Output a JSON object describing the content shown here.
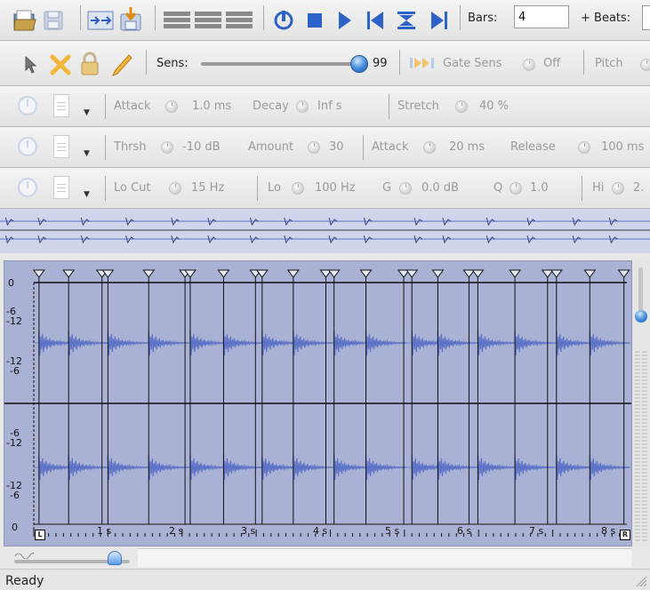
{
  "toolbar": {
    "bars_label": "Bars:",
    "bars_value": "4",
    "beats_label": "+ Beats:"
  },
  "toolbar2": {
    "sens_label": "Sens:",
    "sens_value": "99",
    "sens_level": 0.99,
    "gate_sens_label": "Gate Sens",
    "off_label": "Off",
    "pitch_label": "Pitch"
  },
  "envelope": {
    "attack_label": "Attack",
    "attack_value": "1.0 ms",
    "decay_label": "Decay",
    "decay_value": "Inf s",
    "stretch_label": "Stretch",
    "stretch_value": "40 %"
  },
  "compressor": {
    "thrsh_label": "Thrsh",
    "thrsh_value": "-10 dB",
    "amount_label": "Amount",
    "amount_value": "30",
    "attack_label": "Attack",
    "attack_value": "20 ms",
    "release_label": "Release",
    "release_value": "100 ms"
  },
  "eq": {
    "locut_label": "Lo Cut",
    "locut_value": "15 Hz",
    "lo_label": "Lo",
    "lo_value": "100 Hz",
    "g_label": "G",
    "g_value": "0.0 dB",
    "q_label": "Q",
    "q_value": "1.0",
    "hi_label": "Hi",
    "hi_value": "2."
  },
  "waveform": {
    "db_labels": [
      "0",
      "-6",
      "-12",
      "-12",
      "-6",
      "-6",
      "-12",
      "-12",
      "-6",
      "0"
    ],
    "time_labels": [
      "1 s",
      "2 s",
      "3 s",
      "4 s",
      "5 s",
      "6 s",
      "7 s",
      "8 s"
    ],
    "marker_left": "L",
    "marker_right": "R",
    "slice_times": [
      0.07,
      0.47,
      0.92,
      1.0,
      1.55,
      2.04,
      2.11,
      2.56,
      2.99,
      3.08,
      3.5,
      3.94,
      4.05,
      4.48,
      4.99,
      5.1,
      5.45,
      5.87,
      5.99,
      6.49,
      6.93,
      7.05,
      7.5,
      7.96
    ],
    "hit_times": [
      0.07,
      0.47,
      1.0,
      1.55,
      2.11,
      2.56,
      3.08,
      3.5,
      4.05,
      4.48,
      5.1,
      5.45,
      5.99,
      6.49,
      7.05,
      7.5
    ],
    "duration_s": 8.0
  },
  "colors": {
    "wave_bg": "#a9b1d4",
    "wave": "#5c72c6",
    "slider_knob": "#3f87d8"
  },
  "status": {
    "text": "Ready"
  }
}
